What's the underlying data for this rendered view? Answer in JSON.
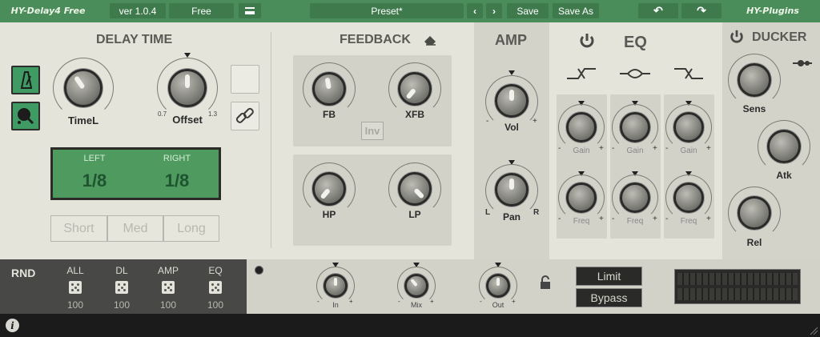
{
  "topbar": {
    "title": "HY-Delay4 Free",
    "version": "ver 1.0.4",
    "edition": "Free",
    "preset": "Preset*",
    "save": "Save",
    "save_as": "Save As",
    "brand": "HY-Plugins"
  },
  "delay": {
    "title": "DELAY TIME",
    "time_label": "TimeL",
    "offset_label": "Offset",
    "offset_min": "0.7",
    "offset_max": "1.3",
    "display_left_label": "LEFT",
    "display_right_label": "RIGHT",
    "display_left_value": "1/8",
    "display_right_value": "1/8",
    "modes": [
      "Short",
      "Med",
      "Long"
    ]
  },
  "feedback": {
    "title": "FEEDBACK",
    "fb": "FB",
    "xfb": "XFB",
    "inv": "Inv",
    "hp": "HP",
    "lp": "LP"
  },
  "amp": {
    "title": "AMP",
    "vol": "Vol",
    "pan": "Pan",
    "vol_minus": "-",
    "vol_plus": "+",
    "pan_l": "L",
    "pan_r": "R"
  },
  "eq": {
    "title": "EQ",
    "gain": "Gain",
    "freq": "Freq",
    "minus": "-",
    "plus": "+"
  },
  "ducker": {
    "title": "DUCKER",
    "sens": "Sens",
    "atk": "Atk",
    "rel": "Rel"
  },
  "bottom": {
    "rnd": "RND",
    "groups": [
      {
        "label": "ALL",
        "value": "100"
      },
      {
        "label": "DL",
        "value": "100"
      },
      {
        "label": "AMP",
        "value": "100"
      },
      {
        "label": "EQ",
        "value": "100"
      }
    ],
    "in": "In",
    "mix": "Mix",
    "out": "Out",
    "limit": "Limit",
    "bypass": "Bypass"
  },
  "colors": {
    "accent": "#4a8c5a",
    "display": "#4e9a5f",
    "panel": "#e4e4da",
    "amp_bg": "#d3d3ca"
  },
  "icons": [
    "metronome-icon",
    "sync-icon",
    "eraser-icon",
    "power-icon",
    "link-icon",
    "lock-icon",
    "info-icon",
    "undo-icon",
    "redo-icon",
    "menu-icon",
    "chevron-left-icon",
    "chevron-right-icon",
    "dice-icon"
  ]
}
